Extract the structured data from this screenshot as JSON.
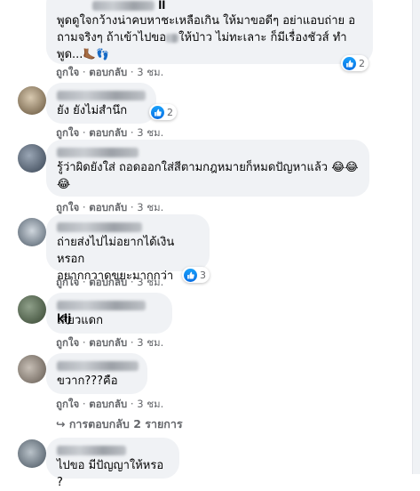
{
  "comments": [
    {
      "author_suffix": "ll",
      "lines": [
        "พูดดูใจกว้างน่าคบหาชะเหลือเกิน ให้มาขอดีๆ อย่าแอบถ่าย อ",
        "ถามจริงๆ ถ้าเข้าไปขอ",
        "ให้ป่าว ไม่ทะเลาะ ก็มีเรื่องชัวส์ ทำ",
        "พูด..."
      ],
      "like": "ถูกใจ",
      "reply": "ตอบกลับ",
      "time": "3 ชม.",
      "reactions": "2"
    },
    {
      "author_suffix": "",
      "lines": [
        "ยัง ยังไม่สำนึก"
      ],
      "like": "ถูกใจ",
      "reply": "ตอบกลับ",
      "time": "3 ชม.",
      "reactions": "2"
    },
    {
      "author_suffix": "",
      "lines": [
        "รู้ว่าผิดยังใส่ ถอดออกใส่สีตามกฎหมายก็หมดปัญหาแล้ว 😂😂",
        "😂"
      ],
      "like": "ถูกใจ",
      "reply": "ตอบกลับ",
      "time": "3 ชม."
    },
    {
      "author_suffix": "",
      "lines": [
        "ถ่ายส่งไปไม่อยากได้เงินหรอก",
        "อยากกวาดขยะมากกว่า"
      ],
      "like": "ถูกใจ",
      "reply": "ตอบกลับ",
      "time": "3 ชม.",
      "reactions": "3"
    },
    {
      "author_suffix": "kij",
      "lines": [
        "เสียวแดก"
      ],
      "like": "ถูกใจ",
      "reply": "ตอบกลับ",
      "time": "3 ชม."
    },
    {
      "author_suffix": "",
      "lines": [
        "ขวาก???คือ"
      ],
      "like": "ถูกใจ",
      "reply": "ตอบกลับ",
      "time": "3 ชม."
    },
    {
      "author_suffix": "",
      "lines": [
        "ไปขอ มีปัญญาให้หรอ ?"
      ]
    }
  ],
  "replies_link": "↪ การตอบกลับ 2 รายการ",
  "colors": {
    "bubble": "#f0f2f5",
    "meta_text": "#65676b",
    "like_blue": "#1877f2"
  }
}
